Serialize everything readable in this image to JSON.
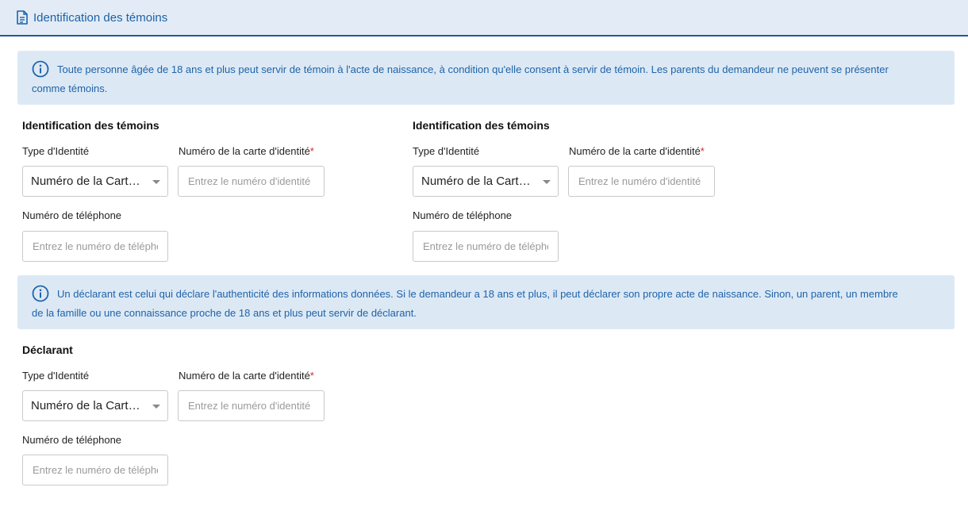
{
  "header": {
    "title": "Identification des témoins",
    "icon": "document-icon"
  },
  "info_witness": {
    "icon": "info-icon",
    "text": "Toute personne âgée de 18 ans et plus peut servir de témoin à l'acte de naissance, à condition qu'elle consent à servir de témoin. Les parents du demandeur ne peuvent se présenter comme témoins."
  },
  "witness1": {
    "title": "Identification des témoins",
    "id_type_label": "Type d'Identité",
    "id_type_value": "Numéro de la Carte d'identité",
    "id_number_label": "Numéro de la carte d'identité",
    "required_mark": "*",
    "id_number_placeholder": "Entrez le numéro d'identité",
    "phone_label": "Numéro de téléphone",
    "phone_placeholder": "Entrez le numéro de téléphone"
  },
  "witness2": {
    "title": "Identification des témoins",
    "id_type_label": "Type d'Identité",
    "id_type_value": "Numéro de la Carte d'identité",
    "id_number_label": "Numéro de la carte d'identité",
    "required_mark": "*",
    "id_number_placeholder": "Entrez le numéro d'identité",
    "phone_label": "Numéro de téléphone",
    "phone_placeholder": "Entrez le numéro de téléphone"
  },
  "info_declarant": {
    "icon": "info-icon",
    "text": "Un déclarant est celui qui déclare l'authenticité des informations données. Si le demandeur a 18 ans et plus, il peut déclarer son propre acte de naissance. Sinon, un parent, un membre de la famille ou une connaissance proche de 18 ans et plus peut servir de déclarant."
  },
  "declarant": {
    "title": "Déclarant",
    "id_type_label": "Type d'Identité",
    "id_type_value": "Numéro de la Carte d'identité",
    "id_number_label": "Numéro de la carte d'identité",
    "required_mark": "*",
    "id_number_placeholder": "Entrez le numéro d'identité",
    "phone_label": "Numéro de téléphone",
    "phone_placeholder": "Entrez le numéro de téléphone"
  },
  "colors": {
    "accent": "#1c62a8",
    "info_bg": "#dce9f5",
    "header_bg": "#e3ecf6",
    "required": "#d9242b"
  }
}
